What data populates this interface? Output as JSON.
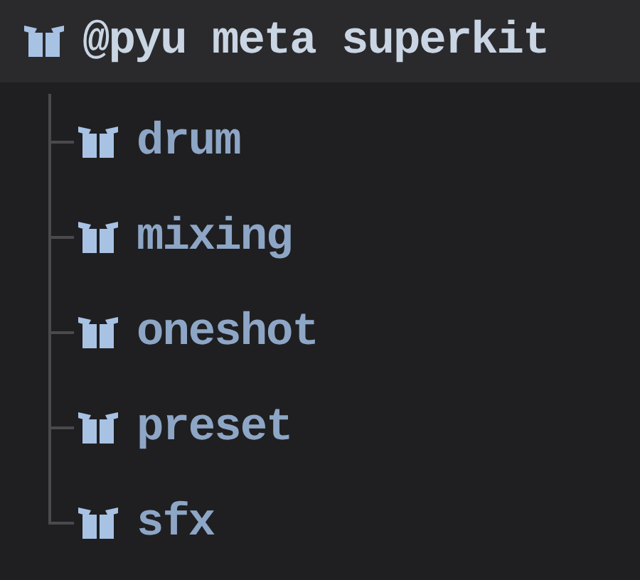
{
  "tree": {
    "label": "@pyu meta superkit",
    "children": [
      {
        "label": "drum"
      },
      {
        "label": "mixing"
      },
      {
        "label": "oneshot"
      },
      {
        "label": "preset"
      },
      {
        "label": "sfx"
      }
    ]
  }
}
